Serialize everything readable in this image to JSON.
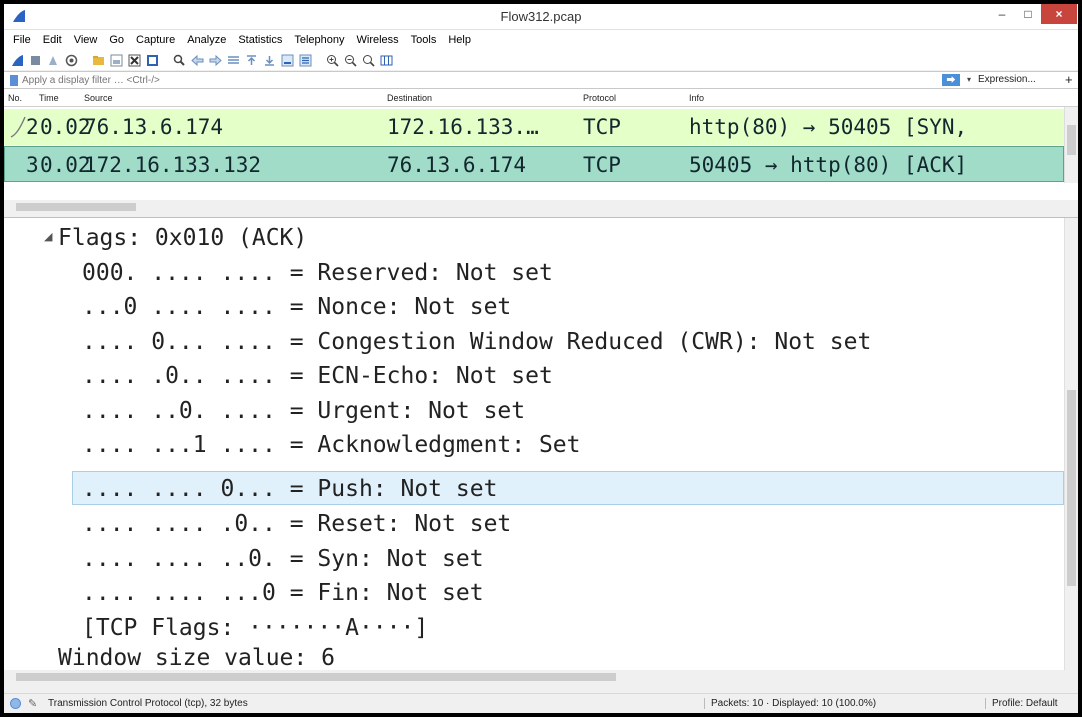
{
  "window": {
    "title": "Flow312.pcap",
    "minimize": "–",
    "maximize": "□",
    "close": "×"
  },
  "menu": [
    "File",
    "Edit",
    "View",
    "Go",
    "Capture",
    "Analyze",
    "Statistics",
    "Telephony",
    "Wireless",
    "Tools",
    "Help"
  ],
  "toolbar_icons": [
    "shark-fin-start-icon",
    "stop-icon",
    "restart-icon",
    "options-icon",
    "open-folder-icon",
    "save-icon",
    "close-file-icon",
    "reload-icon",
    "find-icon",
    "back-icon",
    "forward-icon",
    "goto-icon",
    "first-icon",
    "last-icon",
    "autoscroll-icon",
    "colorize-icon",
    "zoom-in-icon",
    "zoom-out-icon",
    "zoom-reset-icon",
    "resize-columns-icon"
  ],
  "filter": {
    "placeholder": "Apply a display filter … <Ctrl-/>",
    "apply": "⮕",
    "dropdown": "▾",
    "expression": "Expression...",
    "plus": "+"
  },
  "packet_list": {
    "columns": [
      "No.",
      "Time",
      "Source",
      "Destination",
      "Protocol",
      "Info"
    ],
    "rows": [
      {
        "no": "2",
        "time": "0.02",
        "source": "76.13.6.174",
        "destination": "172.16.133.…",
        "protocol": "TCP",
        "info": "http(80) → 50405 [SYN,"
      },
      {
        "no": "3",
        "time": "0.02",
        "source": "172.16.133.132",
        "destination": "76.13.6.174",
        "protocol": "TCP",
        "info": "50405 → http(80) [ACK]"
      }
    ]
  },
  "detail": {
    "lines": [
      "Flags: 0x010 (ACK)",
      "000. .... .... = Reserved: Not set",
      "...0 .... .... = Nonce: Not set",
      ".... 0... .... = Congestion Window Reduced (CWR): Not set",
      ".... .0.. .... = ECN-Echo: Not set",
      ".... ..0. .... = Urgent: Not set",
      ".... ...1 .... = Acknowledgment: Set",
      ".... .... 0... = Push: Not set",
      ".... .... .0.. = Reset: Not set",
      ".... .... ..0. = Syn: Not set",
      ".... .... ...0 = Fin: Not set",
      "[TCP Flags: ·······A····]",
      "Window size value: 6"
    ],
    "collapse_glyph": "◢"
  },
  "status": {
    "edit_glyph": "✎",
    "text": "Transmission Control Protocol (tcp), 32 bytes",
    "packets": "Packets: 10 · Displayed: 10 (100.0%)",
    "profile": "Profile: Default"
  },
  "colors": {
    "row_syn": "#e4ffc7",
    "row_selected": "#a0dcc8",
    "detail_selected": "#e0f1fb",
    "close_button": "#c7453c"
  }
}
